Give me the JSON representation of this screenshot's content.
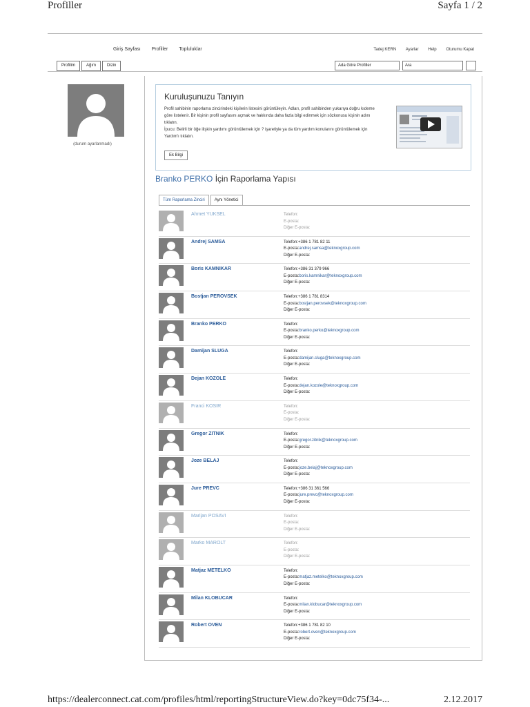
{
  "print_header": {
    "title": "Profiller",
    "page": "Sayfa 1 / 2"
  },
  "print_footer": {
    "url": "https://dealerconnect.cat.com/profiles/html/reportingStructureView.do?key=0dc75f34-...",
    "date": "2.12.2017"
  },
  "top_nav": {
    "home": "Giriş Sayfası",
    "profiles": "Profiller",
    "communities": "Topluluklar"
  },
  "user_nav": {
    "user": "Tadej KERN",
    "settings": "Ayarlar",
    "help": "Help",
    "logout": "Oturumu Kapat"
  },
  "tabs": {
    "my_profile": "Profilim",
    "network": "Ağım",
    "directory": "Dizin"
  },
  "search": {
    "scope": "Ada Göre Profiller",
    "placeholder": "Ara"
  },
  "status": "(durum ayarlanmadı)",
  "welcome": {
    "title": "Kuruluşunuzu Tanıyın",
    "body_1": "Profil sahibinin raporlama zincirindeki kişilerin listesini görüntüleyin. Adları, profil sahibinden yukarıya doğru kıdeme göre listelenir. Bir kişinin profil sayfasını açmak ve hakkında daha fazla bilgi edinmek için sözkonusu kişinin adını tıklatın.",
    "body_2": "İpucu: Belirli bir öğe ilişkin yardımı görüntülemek için ? işaretiyle ya da tüm yardım konularını görüntülemek için Yardım'ı tıklatın.",
    "more_button": "Ek Bilgi"
  },
  "section": {
    "name": "Branko PERKO",
    "title_suffix": "İçin Raporlama Yapısı"
  },
  "sub_tabs": {
    "full_chain": "Tüm Raporlama Zinciri",
    "same_manager": "Aynı Yönetici"
  },
  "labels": {
    "phone": "Telefon:",
    "email": "E-posta:",
    "other_email": "Diğer E-posta:"
  },
  "people": [
    {
      "name": "Ahmet YUKSEL",
      "phone": "",
      "email": "",
      "active": false
    },
    {
      "name": "Andrej SAMSA",
      "phone": "+386 1 781 82 11",
      "email": "andrej.samsa@teknoxgroup.com",
      "active": true
    },
    {
      "name": "Boris KAMNIKAR",
      "phone": "+386 31 379 966",
      "email": "boris.kamnikar@teknoxgroup.com",
      "active": true
    },
    {
      "name": "Bostjan PEROVSEK",
      "phone": "+386 1 781 8314",
      "email": "bostjan.perovsek@teknoxgroup.com",
      "active": true
    },
    {
      "name": "Branko PERKO",
      "phone": "",
      "email": "branko.perko@teknoxgroup.com",
      "active": true
    },
    {
      "name": "Damijan SLUGA",
      "phone": "",
      "email": "damijan.sluga@teknoxgroup.com",
      "active": true
    },
    {
      "name": "Dejan KOZOLE",
      "phone": "",
      "email": "dejan.kozole@teknoxgroup.com",
      "active": true
    },
    {
      "name": "Franci KOSIR",
      "phone": "",
      "email": "",
      "active": false
    },
    {
      "name": "Gregor ZITNIK",
      "phone": "",
      "email": "gregor.zitnik@teknoxgroup.com",
      "active": true
    },
    {
      "name": "Joze BELAJ",
      "phone": "",
      "email": "joze.belaj@teknoxgroup.com",
      "active": true
    },
    {
      "name": "Jure PREVC",
      "phone": "+386 31 361 566",
      "email": "jure.prevc@teknoxgroup.com",
      "active": true
    },
    {
      "name": "Marijan POSAVI",
      "phone": "",
      "email": "",
      "active": false
    },
    {
      "name": "Marko MAROLT",
      "phone": "",
      "email": "",
      "active": false
    },
    {
      "name": "Matjaz METELKO",
      "phone": "",
      "email": "matjaz.metelko@teknoxgroup.com",
      "active": true
    },
    {
      "name": "Milan KLOBUCAR",
      "phone": "",
      "email": "milan.klobucar@teknoxgroup.com",
      "active": true
    },
    {
      "name": "Robert OVEN",
      "phone": "+386 1 781 82 10",
      "email": "robert.oven@teknoxgroup.com",
      "active": true
    }
  ]
}
